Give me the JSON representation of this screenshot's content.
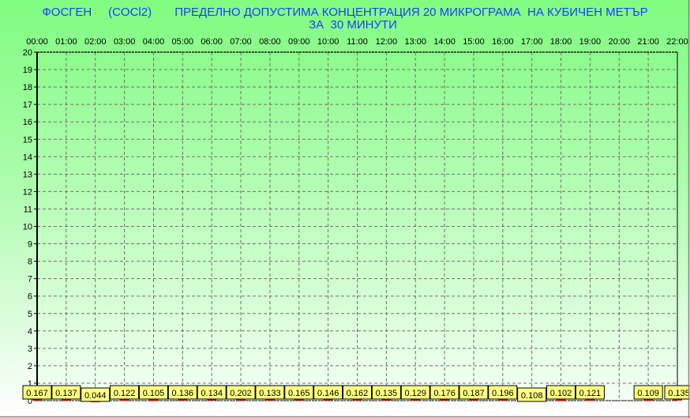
{
  "title_line1": "ФОСГЕН     (COCl2)       ПРЕДЕЛНО ДОПУСТИМА КОНЦЕНТРАЦИЯ 20 МИКРОГРАМА  НА КУБИЧЕН МЕТЪР",
  "title_line2": "ЗА  30 МИНУТИ",
  "chart_data": {
    "type": "bar",
    "title": "ФОСГЕН (COCl2) ПРЕДЕЛНО ДОПУСТИМА КОНЦЕНТРАЦИЯ 20 МИКРОГРАМА НА КУБИЧЕН МЕТЪР ЗА 30 МИНУТИ",
    "categories": [
      "00:00",
      "01:00",
      "02:00",
      "03:00",
      "04:00",
      "05:00",
      "06:00",
      "07:00",
      "08:00",
      "09:00",
      "10:00",
      "11:00",
      "12:00",
      "13:00",
      "14:00",
      "15:00",
      "16:00",
      "17:00",
      "18:00",
      "19:00",
      "20:00",
      "21:00",
      "22:00"
    ],
    "values": [
      0.167,
      0.137,
      0.044,
      0.122,
      0.105,
      0.136,
      0.134,
      0.202,
      0.133,
      0.165,
      0.146,
      0.162,
      0.135,
      0.129,
      0.176,
      0.187,
      0.196,
      0.108,
      0.102,
      0.121,
      null,
      0.109,
      0.135
    ],
    "ylim": [
      0,
      20
    ],
    "yticks": [
      0,
      1,
      2,
      3,
      4,
      5,
      6,
      7,
      8,
      9,
      10,
      11,
      12,
      13,
      14,
      15,
      16,
      17,
      18,
      19,
      20
    ],
    "xaxis_position": "top",
    "grid": true,
    "colors": {
      "bar": "#c02020",
      "label_bg": "#ffff80",
      "title": "#1a3cff"
    }
  }
}
